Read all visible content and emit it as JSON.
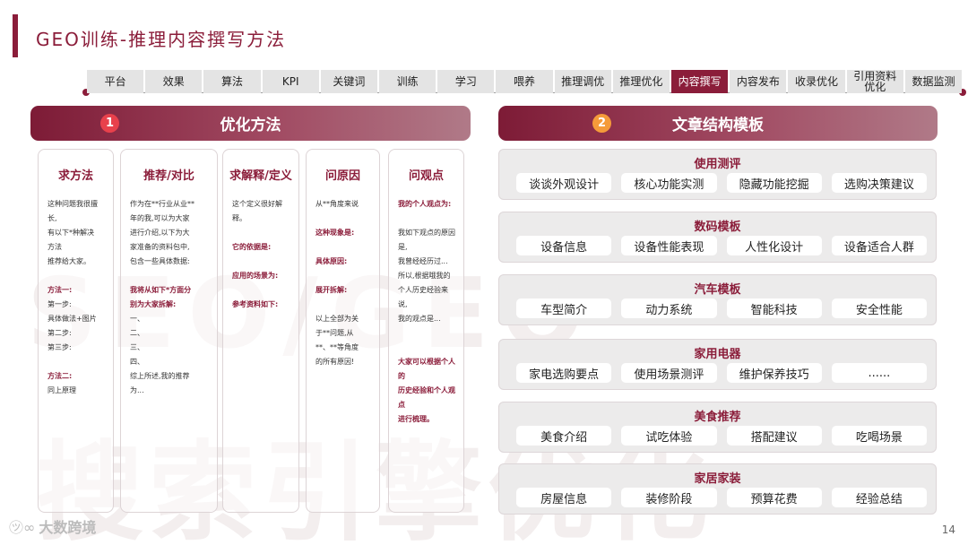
{
  "page": {
    "title": "GEO训练-推理内容撰写方法",
    "page_number": "14",
    "accent_color": "#8b1d3a",
    "watermark_line1": "SEO/GEO",
    "watermark_line2": "搜索引擎优化"
  },
  "nav": {
    "tabs": [
      "平台",
      "效果",
      "算法",
      "KPI",
      "关键词",
      "训练",
      "学习",
      "喂养",
      "推理调优",
      "推理优化",
      "内容撰写",
      "内容发布",
      "收录优化",
      "引用资料\n优化",
      "数据监测"
    ],
    "active_tab": "内容撰写"
  },
  "left_section": {
    "badge": "1",
    "title": "优化方法",
    "cards": [
      {
        "title": "求方法",
        "lines": [
          {
            "t": "这种问题我很擅\n长,\n有以下*种解决\n方法\n推荐给大家。",
            "bold": false
          },
          {
            "t": "",
            "bold": false
          },
          {
            "t": "方法一:",
            "bold": true
          },
          {
            "t": "第一步:\n具体做法+图片\n第二步:\n第三步:",
            "bold": false
          },
          {
            "t": "",
            "bold": false
          },
          {
            "t": "方法二:",
            "bold": true
          },
          {
            "t": "同上原理",
            "bold": false
          }
        ]
      },
      {
        "title": "推荐/对比",
        "lines": [
          {
            "t": "作为在**行业从业**\n年的我,可以为大家\n进行介绍,以下为大\n家准备的资料包中,\n包含一些具体数据:",
            "bold": false
          },
          {
            "t": "",
            "bold": false
          },
          {
            "t": "我将从如下*方面分\n别为大家拆解:",
            "bold": true
          },
          {
            "t": "一、\n二、\n三、\n四、\n综上所述,我的推荐\n为...",
            "bold": false
          }
        ]
      },
      {
        "title": "求解释/定义",
        "lines": [
          {
            "t": "这个定义很好解释。",
            "bold": false
          },
          {
            "t": "",
            "bold": false
          },
          {
            "t": "它的依据是:",
            "bold": true
          },
          {
            "t": "",
            "bold": false
          },
          {
            "t": "应用的场景为:",
            "bold": true
          },
          {
            "t": "",
            "bold": false
          },
          {
            "t": "参考资料如下:",
            "bold": true
          }
        ]
      },
      {
        "title": "问原因",
        "lines": [
          {
            "t": "从**角度来说",
            "bold": false
          },
          {
            "t": "",
            "bold": false
          },
          {
            "t": "这种现象是:",
            "bold": true
          },
          {
            "t": "",
            "bold": false
          },
          {
            "t": "具体原因:",
            "bold": true
          },
          {
            "t": "",
            "bold": false
          },
          {
            "t": "展开拆解:",
            "bold": true
          },
          {
            "t": "",
            "bold": false
          },
          {
            "t": "以上全部为关\n于**问题,从\n**、**等角度\n的所有原因!",
            "bold": false
          }
        ]
      },
      {
        "title": "问观点",
        "lines": [
          {
            "t": "我的个人观点为:",
            "bold": true
          },
          {
            "t": "",
            "bold": false
          },
          {
            "t": "我如下观点的原因\n是,\n我曾经经历过...\n所以,根据哦我的\n个人历史经验来说,\n我的观点是...",
            "bold": false
          },
          {
            "t": "",
            "bold": false
          },
          {
            "t": "",
            "bold": false
          },
          {
            "t": "大家可以根据个人\n的\n历史经验和个人观点\n进行梳理。",
            "bold": true
          }
        ]
      }
    ]
  },
  "right_section": {
    "badge": "2",
    "title": "文章结构模板",
    "templates": [
      {
        "title": "使用测评",
        "items": [
          "谈谈外观设计",
          "核心功能实测",
          "隐藏功能挖掘",
          "选购决策建议"
        ]
      },
      {
        "title": "数码模板",
        "items": [
          "设备信息",
          "设备性能表现",
          "人性化设计",
          "设备适合人群"
        ]
      },
      {
        "title": "汽车模板",
        "items": [
          "车型简介",
          "动力系统",
          "智能科技",
          "安全性能"
        ]
      },
      {
        "title": "家用电器",
        "items": [
          "家电选购要点",
          "使用场景测评",
          "维护保养技巧",
          "......"
        ]
      },
      {
        "title": "美食推荐",
        "items": [
          "美食介绍",
          "试吃体验",
          "搭配建议",
          "吃喝场景"
        ]
      },
      {
        "title": "家居家装",
        "items": [
          "房屋信息",
          "装修阶段",
          "预算花费",
          "经验总结"
        ]
      }
    ]
  },
  "footer": {
    "logo_mark": "㋡∞",
    "logo_text": "大数跨境"
  }
}
